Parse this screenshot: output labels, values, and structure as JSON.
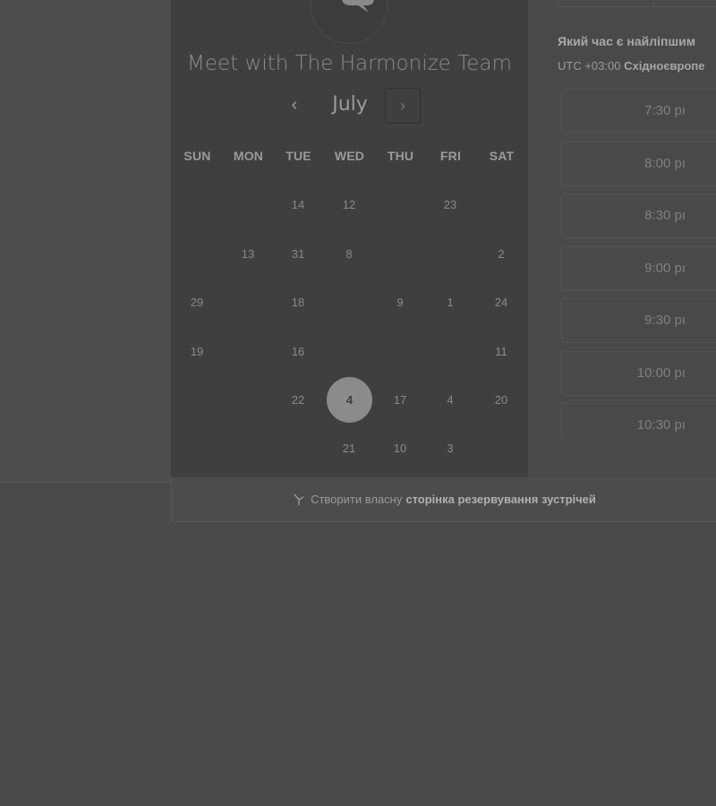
{
  "calendar": {
    "title": "Meet with The Harmonize Team",
    "month": "July",
    "prev_icon": "‹",
    "next_icon": "›",
    "weekdays": [
      "SUN",
      "MON",
      "TUE",
      "WED",
      "THU",
      "FRI",
      "SAT"
    ],
    "days": [
      {
        "label": "14",
        "col": 2,
        "row": 0
      },
      {
        "label": "12",
        "col": 3,
        "row": 0
      },
      {
        "label": "23",
        "col": 5,
        "row": 0
      },
      {
        "label": "13",
        "col": 1,
        "row": 1
      },
      {
        "label": "31",
        "col": 2,
        "row": 1
      },
      {
        "label": "8",
        "col": 3,
        "row": 1
      },
      {
        "label": "2",
        "col": 6,
        "row": 1
      },
      {
        "label": "29",
        "col": 0,
        "row": 2
      },
      {
        "label": "18",
        "col": 2,
        "row": 2
      },
      {
        "label": "9",
        "col": 4,
        "row": 2
      },
      {
        "label": "1",
        "col": 5,
        "row": 2
      },
      {
        "label": "24",
        "col": 6,
        "row": 2
      },
      {
        "label": "19",
        "col": 0,
        "row": 3
      },
      {
        "label": "16",
        "col": 2,
        "row": 3
      },
      {
        "label": "11",
        "col": 6,
        "row": 3
      },
      {
        "label": "22",
        "col": 2,
        "row": 4
      },
      {
        "label": "17",
        "col": 4,
        "row": 4
      },
      {
        "label": "4",
        "col": 5,
        "row": 4
      },
      {
        "label": "20",
        "col": 6,
        "row": 4
      },
      {
        "label": "21",
        "col": 3,
        "row": 5
      },
      {
        "label": "10",
        "col": 4,
        "row": 5
      },
      {
        "label": "3",
        "col": 5,
        "row": 5
      }
    ],
    "selected_day": "4"
  },
  "booking": {
    "question": "Який час є найліпшим",
    "tz_offset": "UTC +03:00",
    "tz_name": "Східноєвропе",
    "slots": [
      "7:30 pı",
      "8:00 pı",
      "8:30 pı",
      "9:00 pı",
      "9:30 pı",
      "10:00 pı",
      "10:30 pı"
    ]
  },
  "footer": {
    "prefix": "Створити власну",
    "link": "сторінка резервування зустрічей"
  }
}
